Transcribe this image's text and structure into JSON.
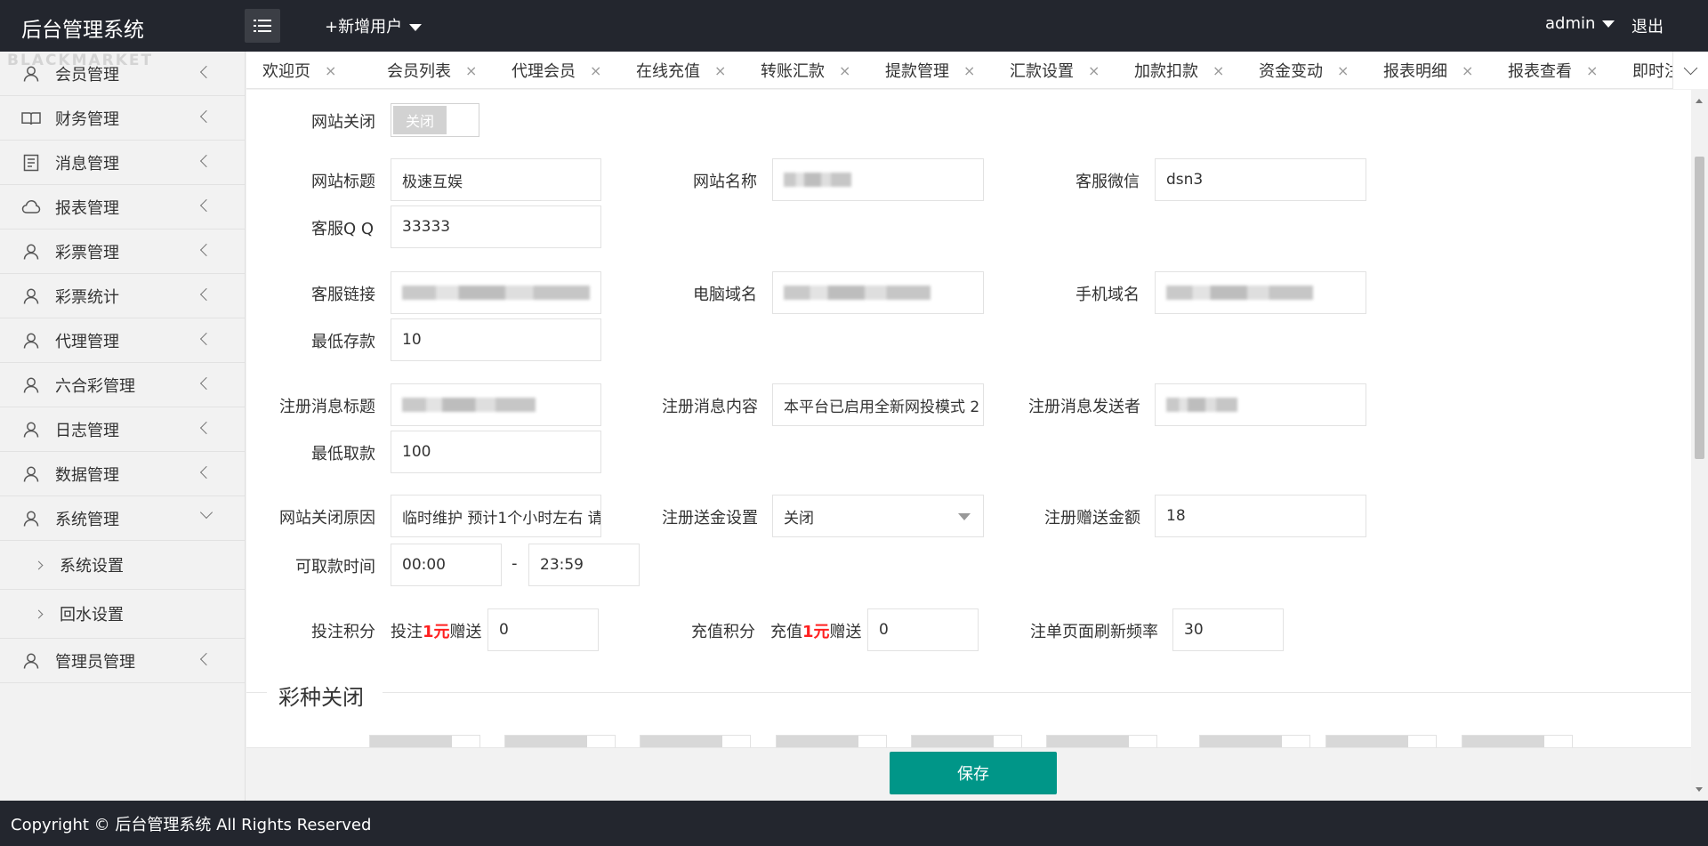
{
  "header": {
    "brand": "后台管理系统",
    "add_user": "+新增用户",
    "admin": "admin",
    "logout": "退出"
  },
  "sidebar": {
    "watermark": "BLACKMARKET",
    "items": [
      {
        "label": "会员管理",
        "icon": "user-icon"
      },
      {
        "label": "财务管理",
        "icon": "book-icon"
      },
      {
        "label": "消息管理",
        "icon": "document-icon"
      },
      {
        "label": "报表管理",
        "icon": "cloud-icon"
      },
      {
        "label": "彩票管理",
        "icon": "user-icon"
      },
      {
        "label": "彩票统计",
        "icon": "user-icon"
      },
      {
        "label": "代理管理",
        "icon": "user-icon"
      },
      {
        "label": "六合彩管理",
        "icon": "user-icon"
      },
      {
        "label": "日志管理",
        "icon": "user-icon"
      },
      {
        "label": "数据管理",
        "icon": "user-icon"
      },
      {
        "label": "系统管理",
        "icon": "user-icon"
      },
      {
        "label": "管理员管理",
        "icon": "user-icon"
      }
    ],
    "sub_items": [
      "系统设置",
      "回水设置"
    ]
  },
  "tabs": [
    "欢迎页",
    "会员列表",
    "代理会员",
    "在线充值",
    "转账汇款",
    "提款管理",
    "汇款设置",
    "加款扣款",
    "资金变动",
    "报表明细",
    "报表查看",
    "即时注单"
  ],
  "tab_close": "×",
  "form": {
    "site_close_label": "网站关闭",
    "site_close_value": "关闭",
    "site_title_label": "网站标题",
    "site_title_value": "极速互娱",
    "site_name_label": "网站名称",
    "cs_wechat_label": "客服微信",
    "cs_wechat_value": "dsn3",
    "cs_qq_label": "客服Q Q",
    "cs_qq_value": "33333",
    "cs_link_label": "客服链接",
    "pc_domain_label": "电脑域名",
    "mobile_domain_label": "手机域名",
    "min_deposit_label": "最低存款",
    "min_deposit_value": "10",
    "reg_msg_title_label": "注册消息标题",
    "reg_msg_content_label": "注册消息内容",
    "reg_msg_content_value": "本平台已启用全新网投模式 2",
    "reg_msg_sender_label": "注册消息发送者",
    "min_withdraw_label": "最低取款",
    "min_withdraw_value": "100",
    "close_reason_label": "网站关闭原因",
    "close_reason_value": "临时维护 预计1个小时左右 请",
    "reg_bonus_setting_label": "注册送金设置",
    "reg_bonus_setting_value": "关闭",
    "reg_bonus_amount_label": "注册赠送金额",
    "reg_bonus_amount_value": "18",
    "withdraw_time_label": "可取款时间",
    "withdraw_time_start": "00:00",
    "withdraw_time_dash": "-",
    "withdraw_time_end": "23:59",
    "bet_points_label": "投注积分",
    "bet_points_prefix": "投注",
    "bet_points_red": "1元",
    "bet_points_suffix": "赠送",
    "bet_points_value": "0",
    "recharge_points_label": "充值积分",
    "recharge_points_prefix": "充值",
    "recharge_points_red": "1元",
    "recharge_points_suffix": "赠送",
    "recharge_points_value": "0",
    "refresh_rate_label": "注单页面刷新频率",
    "refresh_rate_value": "30"
  },
  "section": {
    "title": "彩种关闭"
  },
  "save_label": "保存",
  "footer": "Copyright © 后台管理系统 All Rights Reserved"
}
